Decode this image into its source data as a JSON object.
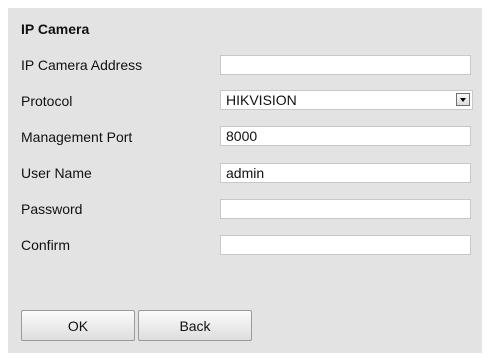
{
  "section": {
    "title": "IP Camera"
  },
  "form": {
    "fields": [
      {
        "label": "IP Camera Address",
        "value": ""
      },
      {
        "label": "Protocol",
        "value": "HIKVISION"
      },
      {
        "label": "Management Port",
        "value": "8000"
      },
      {
        "label": "User Name",
        "value": "admin"
      },
      {
        "label": "Password",
        "value": ""
      },
      {
        "label": "Confirm",
        "value": ""
      }
    ]
  },
  "buttons": {
    "ok_label": "OK",
    "back_label": "Back"
  }
}
